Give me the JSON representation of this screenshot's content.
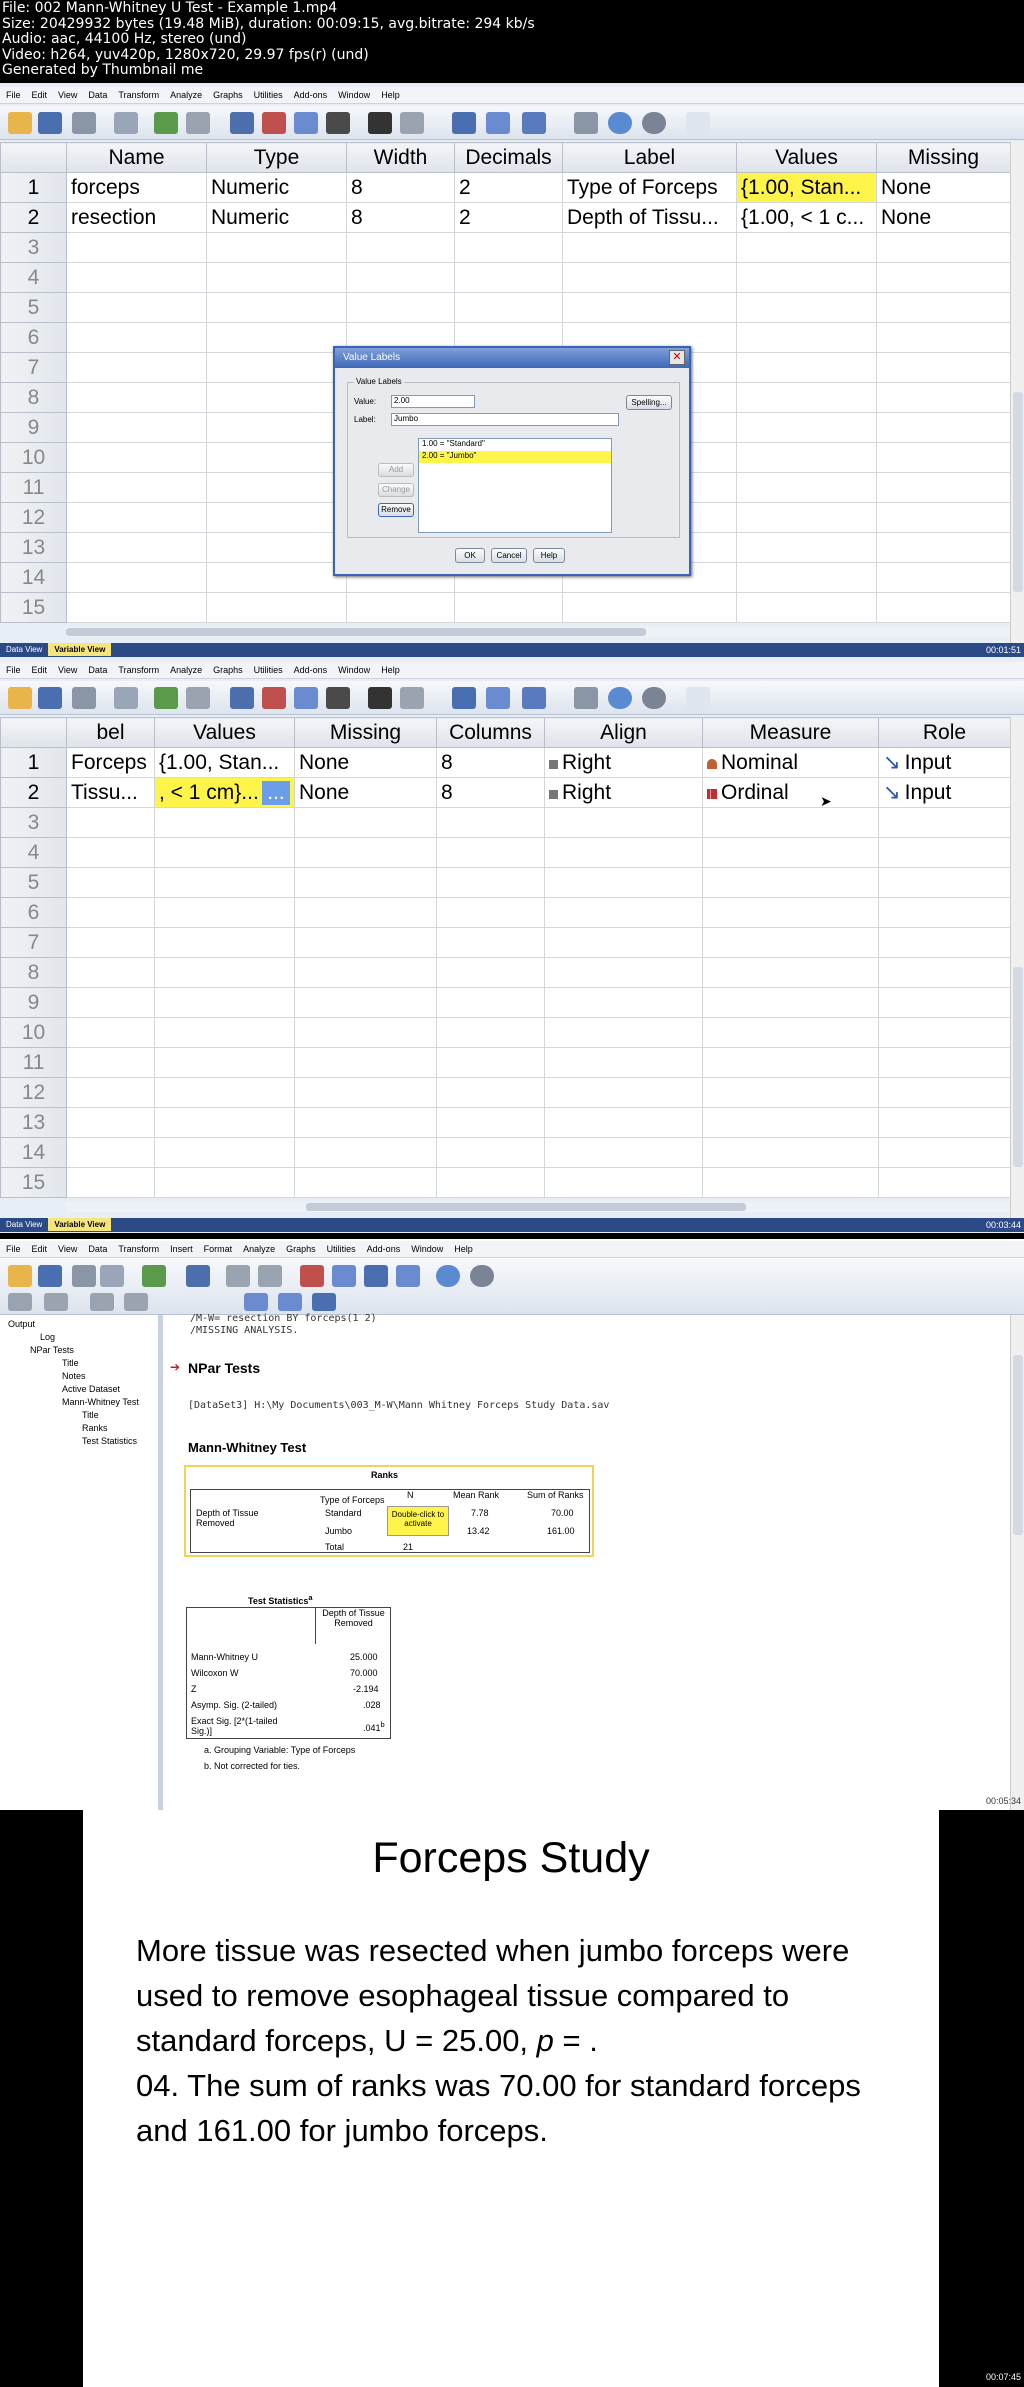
{
  "header": {
    "lines": [
      "File: 002 Mann-Whitney U Test - Example 1.mp4",
      "Size: 20429932 bytes (19.48 MiB), duration: 00:09:15, avg.bitrate: 294 kb/s",
      "Audio: aac, 44100 Hz, stereo (und)",
      "Video: h264, yuv420p, 1280x720, 29.97 fps(r) (und)",
      "Generated by Thumbnail me"
    ]
  },
  "menu": [
    "File",
    "Edit",
    "View",
    "Data",
    "Transform",
    "Analyze",
    "Graphs",
    "Utilities",
    "Add-ons",
    "Window",
    "Help"
  ],
  "viewer_menu": [
    "File",
    "Edit",
    "View",
    "Data",
    "Transform",
    "Insert",
    "Format",
    "Analyze",
    "Graphs",
    "Utilities",
    "Add-ons",
    "Window",
    "Help"
  ],
  "frame1": {
    "columns": [
      "",
      "Name",
      "Type",
      "Width",
      "Decimals",
      "Label",
      "Values",
      "Missing"
    ],
    "rows": [
      [
        "1",
        "forceps",
        "Numeric",
        "8",
        "2",
        "Type of Forceps",
        "{1.00, Stan...",
        "None"
      ],
      [
        "2",
        "resection",
        "Numeric",
        "8",
        "2",
        "Depth of Tissu...",
        "{1.00, < 1 c...",
        "None"
      ]
    ],
    "empty_rows": [
      "3",
      "4",
      "5",
      "6",
      "7",
      "8",
      "9",
      "10",
      "11",
      "12",
      "13",
      "14",
      "15"
    ],
    "tabs": [
      "Data View",
      "Variable View"
    ],
    "timestamp": "00:01:51",
    "dialog": {
      "title": "Value Labels",
      "group": "Value Labels",
      "value_label": "Value:",
      "value": "2.00",
      "label_label": "Label:",
      "label": "Jumbo",
      "spelling": "Spelling...",
      "add": "Add",
      "change": "Change",
      "remove": "Remove",
      "items": [
        "1.00 = \"Standard\"",
        "2.00 = \"Jumbo\""
      ],
      "ok": "OK",
      "cancel": "Cancel",
      "help": "Help"
    }
  },
  "frame2": {
    "columns": [
      "",
      "bel",
      "Values",
      "Missing",
      "Columns",
      "Align",
      "Measure",
      "Role"
    ],
    "rows": [
      [
        "1",
        "Forceps",
        "{1.00, Stan...",
        "None",
        "8",
        "Right",
        "Nominal",
        "Input"
      ],
      [
        "2",
        " Tissu...",
        ", < 1 cm}...",
        "None",
        "8",
        "Right",
        "Ordinal",
        "Input"
      ]
    ],
    "ellipsis": "...",
    "empty_rows": [
      "3",
      "4",
      "5",
      "6",
      "7",
      "8",
      "9",
      "10",
      "11",
      "12",
      "13",
      "14",
      "15"
    ],
    "tabs": [
      "Data View",
      "Variable View"
    ],
    "timestamp": "00:03:44"
  },
  "frame3": {
    "nav": [
      "Output",
      "Log",
      "NPar Tests",
      "Title",
      "Notes",
      "Active Dataset",
      "Mann-Whitney Test",
      "Title",
      "Ranks",
      "Test Statistics"
    ],
    "syntax": [
      "/M-W= resection BY forceps(1 2)",
      "/MISSING ANALYSIS."
    ],
    "npar_title": "NPar Tests",
    "dataset": "[DataSet3] H:\\My Documents\\003_M-W\\Mann Whitney Forceps Study Data.sav",
    "mw_title": "Mann-Whitney Test",
    "ranks": {
      "title": "Ranks",
      "col_group": "Type of Forceps",
      "headers": [
        "N",
        "Mean Rank",
        "Sum of Ranks"
      ],
      "row_label": "Depth of Tissue Removed",
      "rows": [
        {
          "label": "Standard",
          "mean": "7.78",
          "sum": "70.00"
        },
        {
          "label": "Jumbo",
          "mean": "13.42",
          "sum": "161.00"
        },
        {
          "label": "Total",
          "n": "21"
        }
      ],
      "tooltip": "Double-click to activate"
    },
    "stats": {
      "title": "Test Statistics",
      "title_sup": "a",
      "header": "Depth of Tissue Removed",
      "rows": [
        [
          "Mann-Whitney U",
          "25.000"
        ],
        [
          "Wilcoxon W",
          "70.000"
        ],
        [
          "Z",
          "-2.194"
        ],
        [
          "Asymp. Sig. (2-tailed)",
          ".028"
        ],
        [
          "Exact Sig. [2*(1-tailed Sig.)]",
          ".041"
        ]
      ],
      "sup": "b",
      "notes": [
        "a. Grouping Variable: Type of Forceps",
        "b. Not corrected for ties."
      ]
    },
    "timestamp": "00:05:34"
  },
  "slide": {
    "title": "Forceps Study",
    "body_1": "More tissue was resected when jumbo forceps were used to remove esophageal tissue compared to standard forceps, U = 25.00, ",
    "body_p": "p",
    "body_2": " = .",
    "body_3": "04. The sum of ranks was 70.00 for standard forceps and 161.00 for jumbo forceps.",
    "timestamp": "00:07:45"
  }
}
